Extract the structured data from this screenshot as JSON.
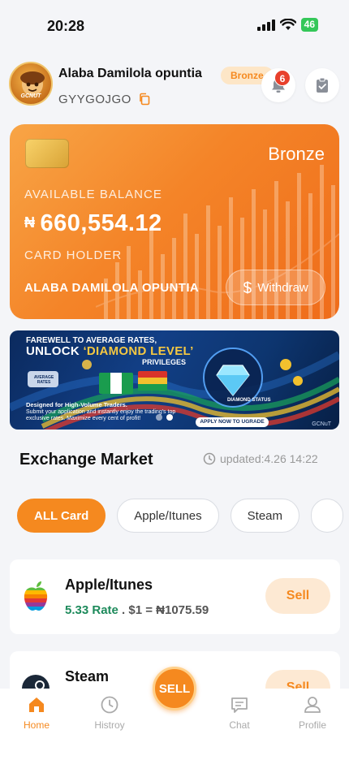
{
  "status_bar": {
    "time": "20:28",
    "battery": "46"
  },
  "header": {
    "avatar_text": "GCNUT",
    "user_name": "Alaba Damilola opuntia",
    "tier": "Bronze",
    "user_code": "GYYGOJGO",
    "notifications_count": "6"
  },
  "card": {
    "tier": "Bronze",
    "available_label": "AVAILABLE BALANCE",
    "currency": "₦",
    "balance": "660,554.12",
    "holder_label": "CARD HOLDER",
    "holder_name": "ALABA DAMILOLA OPUNTIA",
    "withdraw_label": "Withdraw"
  },
  "banner": {
    "line1": "FAREWELL TO AVERAGE RATES,",
    "line2_a": "UNLOCK ",
    "line2_b": "‘DIAMOND LEVEL’",
    "line3": "PRIVILEGES",
    "small_bold": "Designed for High-Volume Traders.",
    "small_text": "Submit your application and instantly enjoy the trading's top exclusive rates. Maximize every cent of profit!",
    "status": "DIAMOND STATUS",
    "cta": "APPLY NOW TO UGRADE",
    "sign": "GCNuT",
    "tag": "AVERAGE RATES"
  },
  "market": {
    "title": "Exchange Market",
    "updated": "updated:4.26 14:22",
    "filters": [
      "ALL Card",
      "Apple/Itunes",
      "Steam"
    ],
    "items": [
      {
        "name": "Apple/Itunes",
        "rate": "5.33 Rate",
        "sep": " . ",
        "eq": "$1 = ₦1075.59",
        "sell": "Sell"
      },
      {
        "name": "Steam",
        "sell": "Sell"
      }
    ]
  },
  "nav": {
    "home": "Home",
    "history": "Histroy",
    "sell": "SELL",
    "chat": "Chat",
    "profile": "Profile"
  },
  "colors": {
    "accent": "#f5891f",
    "rate_green": "#1d8a5b",
    "card_orange": "#f48428"
  }
}
